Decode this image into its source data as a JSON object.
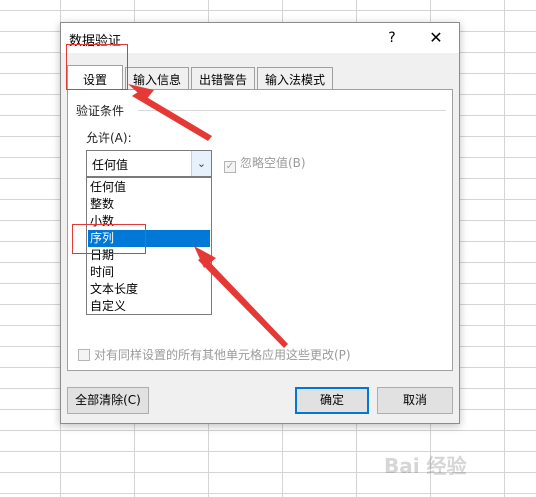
{
  "dialog": {
    "title": "数据验证",
    "help": "?",
    "close": "✕"
  },
  "tabs": [
    "设置",
    "输入信息",
    "出错警告",
    "输入法模式"
  ],
  "settings": {
    "section_title": "验证条件",
    "allow_label": "允许(A):",
    "allow_value": "任何值",
    "ignore_blank": "忽略空值(B)",
    "ignore_blank_checked": true,
    "dropdown_options": [
      "任何值",
      "整数",
      "小数",
      "序列",
      "日期",
      "时间",
      "文本长度",
      "自定义"
    ],
    "selected_option": "序列",
    "apply_all": "对有同样设置的所有其他单元格应用这些更改(P)"
  },
  "buttons": {
    "clear_all": "全部清除(C)",
    "ok": "确定",
    "cancel": "取消"
  },
  "watermark": "Bai 经验",
  "colors": {
    "accent": "#0078d7",
    "annotation": "#e53935"
  }
}
